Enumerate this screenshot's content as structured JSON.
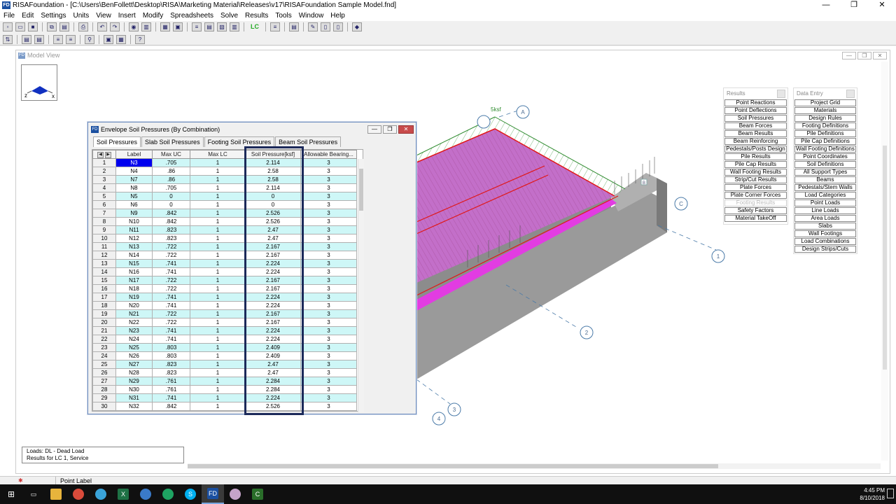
{
  "app": {
    "title": "RISAFoundation - [C:\\Users\\BenFollett\\Desktop\\RISA\\Marketing Material\\Releases\\v17\\RISAFoundation Sample Model.fnd]",
    "icon_text": "FD",
    "window_buttons": [
      "—",
      "❐",
      "✕"
    ]
  },
  "menu": [
    "File",
    "Edit",
    "Settings",
    "Units",
    "View",
    "Insert",
    "Modify",
    "Spreadsheets",
    "Solve",
    "Results",
    "Tools",
    "Window",
    "Help"
  ],
  "toolbar": {
    "lc_label": "LC"
  },
  "model_view": {
    "title": "Model View",
    "axes": {
      "z": "z",
      "x": "x"
    },
    "gridline_labels": [
      "A",
      "C",
      "1",
      "2",
      "3",
      "4"
    ],
    "pressure_label": "5ksf",
    "node_tag": "B"
  },
  "results_panel": {
    "title": "Results",
    "items": [
      {
        "label": "Point Reactions",
        "enabled": true
      },
      {
        "label": "Point Deflections",
        "enabled": true
      },
      {
        "label": "Soil Pressures",
        "enabled": true
      },
      {
        "label": "Beam Forces",
        "enabled": true
      },
      {
        "label": "Beam Results",
        "enabled": true
      },
      {
        "label": "Beam Reinforcing",
        "enabled": true
      },
      {
        "label": "Pedestals/Posts Design",
        "enabled": true
      },
      {
        "label": "Pile Results",
        "enabled": true
      },
      {
        "label": "Pile Cap Results",
        "enabled": true
      },
      {
        "label": "Wall Footing Results",
        "enabled": true
      },
      {
        "label": "Strip/Cut Results",
        "enabled": true
      },
      {
        "label": "Plate Forces",
        "enabled": true
      },
      {
        "label": "Plate Corner Forces",
        "enabled": true
      },
      {
        "label": "Footing Results",
        "enabled": false
      },
      {
        "label": "Safety Factors",
        "enabled": true
      },
      {
        "label": "Material TakeOff",
        "enabled": true
      }
    ]
  },
  "data_entry_panel": {
    "title": "Data Entry",
    "items": [
      "Project Grid",
      "Materials",
      "Design Rules",
      "Footing Definitions",
      "Pile Definitions",
      "Pile Cap Definitions",
      "Wall Footing Definitions",
      "Point Coordinates",
      "Soil Definitions",
      "All Support Types",
      "Beams",
      "Pedestals/Stem Walls",
      "Load Categories",
      "Point Loads",
      "Line Loads",
      "Area Loads",
      "Slabs",
      "Wall Footings",
      "Load Combinations",
      "Design Strips/Cuts"
    ]
  },
  "envelope": {
    "title": "Envelope Soil Pressures (By Combination)",
    "icon_text": "FD",
    "tabs": [
      "Soil Pressures",
      "Slab Soil Pressures",
      "Footing Soil Pressures",
      "Beam Soil Pressures"
    ],
    "columns": [
      "Label",
      "Max UC",
      "Max LC",
      "Soil Pressure[ksf]",
      "Allowable Bearing..."
    ],
    "rows": [
      [
        "N3",
        ".705",
        "1",
        "2.114",
        "3"
      ],
      [
        "N4",
        ".86",
        "1",
        "2.58",
        "3"
      ],
      [
        "N7",
        ".86",
        "1",
        "2.58",
        "3"
      ],
      [
        "N8",
        ".705",
        "1",
        "2.114",
        "3"
      ],
      [
        "N5",
        "0",
        "1",
        "0",
        "3"
      ],
      [
        "N6",
        "0",
        "1",
        "0",
        "3"
      ],
      [
        "N9",
        ".842",
        "1",
        "2.526",
        "3"
      ],
      [
        "N10",
        ".842",
        "1",
        "2.526",
        "3"
      ],
      [
        "N11",
        ".823",
        "1",
        "2.47",
        "3"
      ],
      [
        "N12",
        ".823",
        "1",
        "2.47",
        "3"
      ],
      [
        "N13",
        ".722",
        "1",
        "2.167",
        "3"
      ],
      [
        "N14",
        ".722",
        "1",
        "2.167",
        "3"
      ],
      [
        "N15",
        ".741",
        "1",
        "2.224",
        "3"
      ],
      [
        "N16",
        ".741",
        "1",
        "2.224",
        "3"
      ],
      [
        "N17",
        ".722",
        "1",
        "2.167",
        "3"
      ],
      [
        "N18",
        ".722",
        "1",
        "2.167",
        "3"
      ],
      [
        "N19",
        ".741",
        "1",
        "2.224",
        "3"
      ],
      [
        "N20",
        ".741",
        "1",
        "2.224",
        "3"
      ],
      [
        "N21",
        ".722",
        "1",
        "2.167",
        "3"
      ],
      [
        "N22",
        ".722",
        "1",
        "2.167",
        "3"
      ],
      [
        "N23",
        ".741",
        "1",
        "2.224",
        "3"
      ],
      [
        "N24",
        ".741",
        "1",
        "2.224",
        "3"
      ],
      [
        "N25",
        ".803",
        "1",
        "2.409",
        "3"
      ],
      [
        "N26",
        ".803",
        "1",
        "2.409",
        "3"
      ],
      [
        "N27",
        ".823",
        "1",
        "2.47",
        "3"
      ],
      [
        "N28",
        ".823",
        "1",
        "2.47",
        "3"
      ],
      [
        "N29",
        ".761",
        "1",
        "2.284",
        "3"
      ],
      [
        "N30",
        ".761",
        "1",
        "2.284",
        "3"
      ],
      [
        "N31",
        ".741",
        "1",
        "2.224",
        "3"
      ],
      [
        "N32",
        ".842",
        "1",
        "2.526",
        "3"
      ]
    ]
  },
  "info": {
    "line1": "Loads: DL - Dead Load",
    "line2": "Results for LC 1, Service"
  },
  "status": {
    "text": "Point Label"
  },
  "taskbar": {
    "time": "4:45 PM",
    "date": "8/10/2018"
  },
  "colors": {
    "accent": "#0000ee",
    "row_fill": "#cef7f7",
    "slab": "#c36fc9",
    "highlight": "#1c2a5a"
  }
}
